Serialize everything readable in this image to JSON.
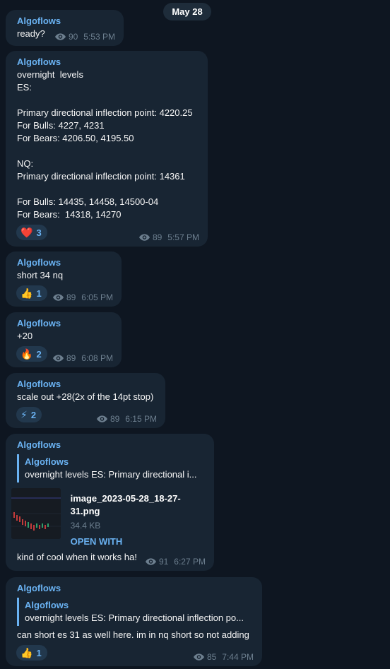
{
  "date": "May 28",
  "messages": [
    {
      "author": "Algoflows",
      "text": "ready?",
      "views": "90",
      "time": "5:53 PM"
    },
    {
      "author": "Algoflows",
      "text": "overnight  levels\nES:\n\nPrimary directional inflection point: 4220.25\nFor Bulls: 4227, 4231\nFor Bears: 4206.50, 4195.50\n\nNQ:\nPrimary directional inflection point: 14361\n\nFor Bulls: 14435, 14458, 14500-04\nFor Bears:  14318, 14270",
      "reaction": {
        "emoji": "❤️",
        "count": "3"
      },
      "views": "89",
      "time": "5:57 PM"
    },
    {
      "author": "Algoflows",
      "text": "short 34 nq",
      "reaction": {
        "emoji": "👍",
        "count": "1"
      },
      "views": "89",
      "time": "6:05 PM"
    },
    {
      "author": "Algoflows",
      "text": "+20",
      "reaction": {
        "emoji": "🔥",
        "count": "2"
      },
      "views": "89",
      "time": "6:08 PM"
    },
    {
      "author": "Algoflows",
      "text": "scale out +28(2x of the 14pt stop)",
      "reaction": {
        "emoji": "⚡",
        "count": "2"
      },
      "views": "89",
      "time": "6:15 PM"
    },
    {
      "author": "Algoflows",
      "quote": {
        "author": "Algoflows",
        "text": "overnight  levels ES:  Primary directional i..."
      },
      "file": {
        "name": "image_2023-05-28_18-27-31.png",
        "size": "34.4 KB",
        "action": "OPEN WITH"
      },
      "text": "kind of cool when it works ha!",
      "views": "91",
      "time": "6:27 PM"
    },
    {
      "author": "Algoflows",
      "quote": {
        "author": "Algoflows",
        "text": "overnight  levels ES:  Primary directional inflection po..."
      },
      "text": "can short es 31 as well here. im in nq short so not adding",
      "reaction": {
        "emoji": "👍",
        "count": "1"
      },
      "views": "85",
      "time": "7:44 PM"
    }
  ]
}
